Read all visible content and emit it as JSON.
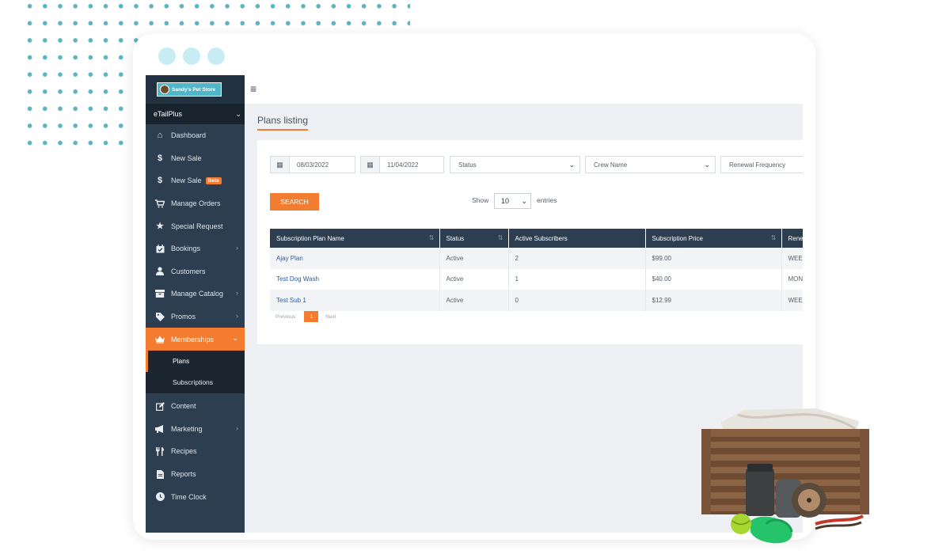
{
  "app": {
    "store_name": "Sandy's Pet Store",
    "account": "eTailPlus"
  },
  "sidebar": {
    "items": [
      {
        "label": "Dashboard",
        "icon": "home-icon"
      },
      {
        "label": "New Sale",
        "icon": "dollar-icon"
      },
      {
        "label": "New Sale",
        "icon": "dollar-icon",
        "badge": "Beta"
      },
      {
        "label": "Manage Orders",
        "icon": "cart-icon"
      },
      {
        "label": "Special Request",
        "icon": "star-icon"
      },
      {
        "label": "Bookings",
        "icon": "calendar-icon"
      },
      {
        "label": "Customers",
        "icon": "user-icon"
      },
      {
        "label": "Manage Catalog",
        "icon": "archive-icon"
      },
      {
        "label": "Promos",
        "icon": "tag-icon"
      },
      {
        "label": "Memberships",
        "icon": "crown-icon"
      }
    ],
    "submenu": [
      {
        "label": "Plans"
      },
      {
        "label": "Subscriptions"
      }
    ],
    "items_after": [
      {
        "label": "Content",
        "icon": "edit-icon"
      },
      {
        "label": "Marketing",
        "icon": "megaphone-icon"
      },
      {
        "label": "Recipes",
        "icon": "utensils-icon"
      },
      {
        "label": "Reports",
        "icon": "document-icon"
      },
      {
        "label": "Time Clock",
        "icon": "clock-icon"
      }
    ]
  },
  "page": {
    "title": "Plans listing"
  },
  "filters": {
    "start_date": "08/03/2022",
    "end_date": "11/04/2022",
    "status": "Status",
    "crew_name": "Crew Name",
    "renewal_frequency": "Renewal Frequency",
    "search_label": "SEARCH",
    "show_label": "Show",
    "entries_value": "10",
    "entries_label": "entries"
  },
  "table": {
    "columns": [
      "Subscription Plan Name",
      "Status",
      "Active Subscribers",
      "Subscription Price",
      "Renewal Frequency"
    ],
    "rows": [
      [
        "Ajay Plan",
        "Active",
        "2",
        "$99.00",
        "WEEKLY"
      ],
      [
        "Test Dog Wash",
        "Active",
        "1",
        "$40.00",
        "MONTHLY"
      ],
      [
        "Test Sub 1",
        "Active",
        "0",
        "$12.99",
        "WEEKLY"
      ]
    ]
  },
  "pagination": {
    "previous": "Previous",
    "current": "1",
    "next": "Next"
  },
  "colors": {
    "accent": "#f47c30",
    "sidebar": "#2c3e50",
    "dots": "#5db5bf"
  }
}
